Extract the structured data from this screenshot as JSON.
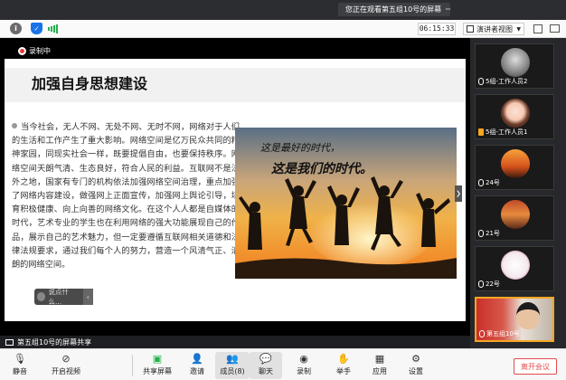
{
  "window": {
    "viewing_notice": "您正在观看第五组10号的屏幕",
    "timer": "06:15:33",
    "view_mode": "演讲者视图"
  },
  "share": {
    "recording_label": "录制中",
    "sharer_label": "第五组10号的屏幕共享"
  },
  "slide": {
    "title": "加强自身思想建设",
    "body": "当今社会，无人不网、无处不网、无时不网，网络对于人们的生活和工作产生了重大影响。网络空间是亿万民众共同的精神家园，同现实社会一样，既要提倡自由，也要保持秩序。网络空间天朗气清、生态良好，符合人民的利益。互联网不是法外之地，国家有专门的机构依法加强网络空间治理，重点加强了网络内容建设，做强网上正面宣传，加强网上舆论引导，培育积极健康、向上向善的网络文化。在这个人人都是自媒体的时代，艺术专业的学生也在利用网络的强大功能展现自己的作品，展示自己的艺术魅力，但一定要遵循互联网相关道德和法律法规要求，通过我们每个人的努力，营造一个风清气正、清朗的网络空间。",
    "image_caption_line1": "这是最好的时代，",
    "image_caption_line2": "这是我们的时代。",
    "comment_placeholder": "说点什么..."
  },
  "participants": [
    {
      "name": "5组-工作人员2"
    },
    {
      "name": "5组-工作人员1"
    },
    {
      "name": "24号"
    },
    {
      "name": "21号"
    },
    {
      "name": "22号"
    },
    {
      "name": "第五组10号"
    }
  ],
  "bottom_bar": {
    "mute": "静音",
    "video": "开启视频",
    "share_screen": "共享屏幕",
    "invite": "邀请",
    "members": "成员(8)",
    "chat": "聊天",
    "record": "录制",
    "raise_hand": "举手",
    "apps": "应用",
    "settings": "设置",
    "leave": "离开会议"
  },
  "colors": {
    "recording_red": "#e53935",
    "active_speaker": "#f5a623",
    "leave_red": "#e34c4c",
    "signal_green": "#22b14c"
  }
}
